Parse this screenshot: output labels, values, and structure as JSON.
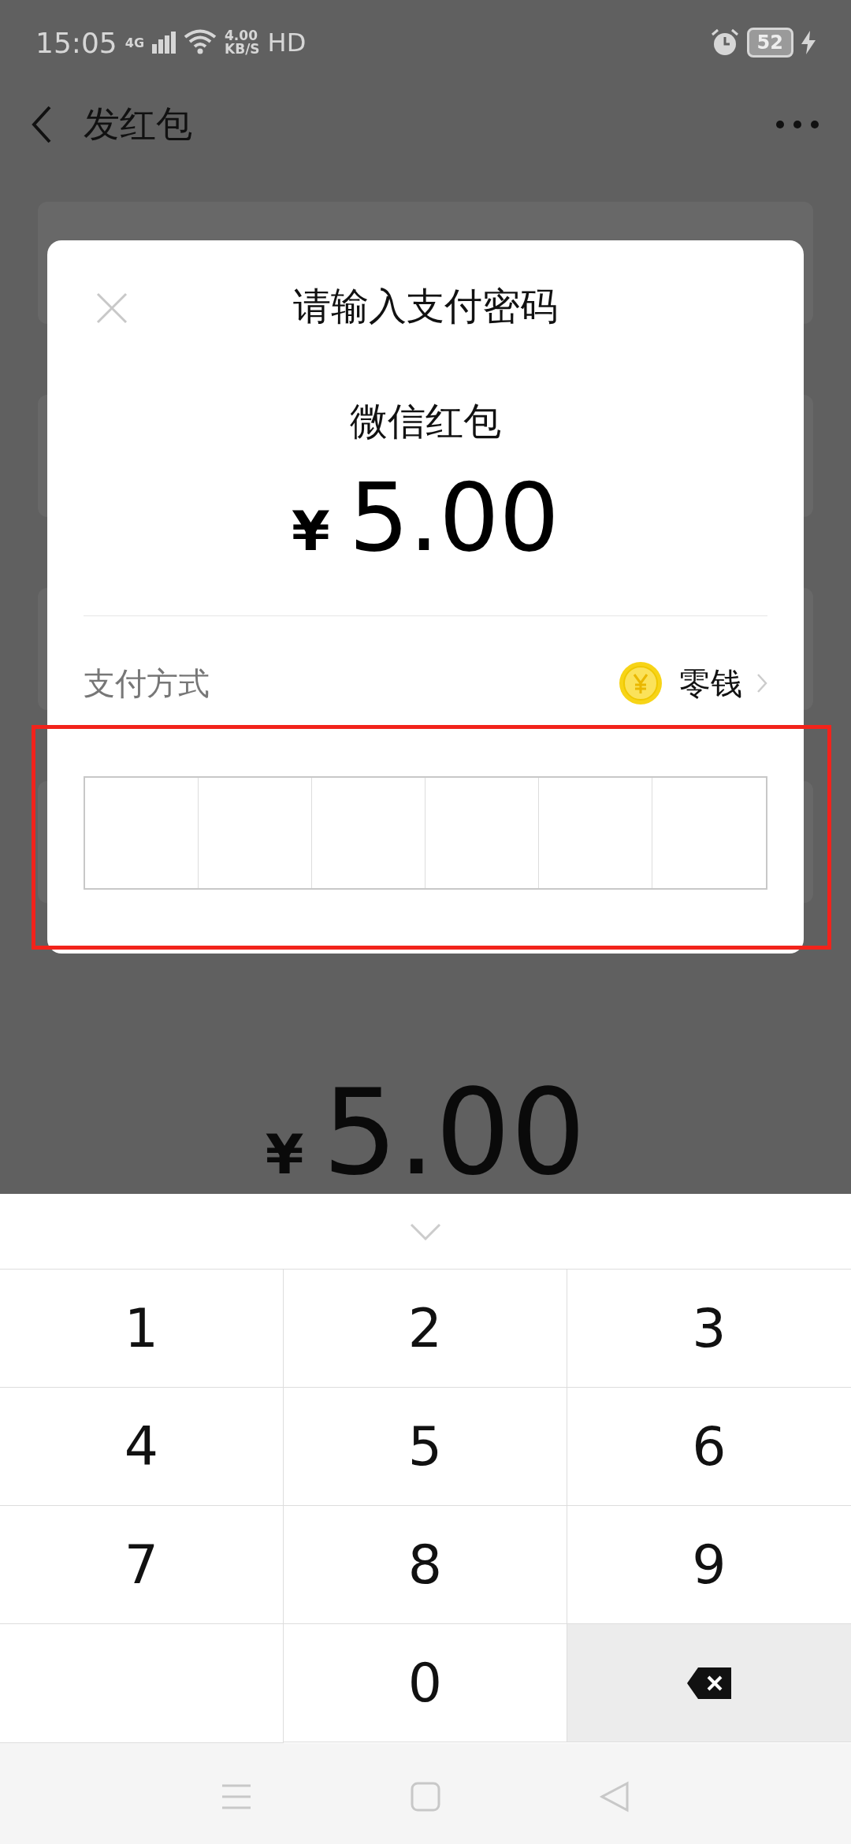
{
  "status_bar": {
    "time": "15:05",
    "network": "4G",
    "speed_value": "4.00",
    "speed_unit": "KB/S",
    "hd": "HD",
    "battery": "52"
  },
  "header": {
    "title": "发红包"
  },
  "background_amount": {
    "currency": "¥",
    "value": "5.00"
  },
  "dialog": {
    "title": "请输入支付密码",
    "product": "微信红包",
    "currency": "¥",
    "amount": "5.00",
    "payment_label": "支付方式",
    "payment_method": "零钱",
    "password_slots": [
      {
        "filled": false
      },
      {
        "filled": false
      },
      {
        "filled": false
      },
      {
        "filled": false
      },
      {
        "filled": false
      },
      {
        "filled": false
      }
    ]
  },
  "keyboard": {
    "keys": [
      {
        "kind": "digit",
        "label": "1"
      },
      {
        "kind": "digit",
        "label": "2"
      },
      {
        "kind": "digit",
        "label": "3"
      },
      {
        "kind": "digit",
        "label": "4"
      },
      {
        "kind": "digit",
        "label": "5"
      },
      {
        "kind": "digit",
        "label": "6"
      },
      {
        "kind": "digit",
        "label": "7"
      },
      {
        "kind": "digit",
        "label": "8"
      },
      {
        "kind": "digit",
        "label": "9"
      },
      {
        "kind": "blank"
      },
      {
        "kind": "digit",
        "label": "0"
      },
      {
        "kind": "delete"
      }
    ]
  }
}
